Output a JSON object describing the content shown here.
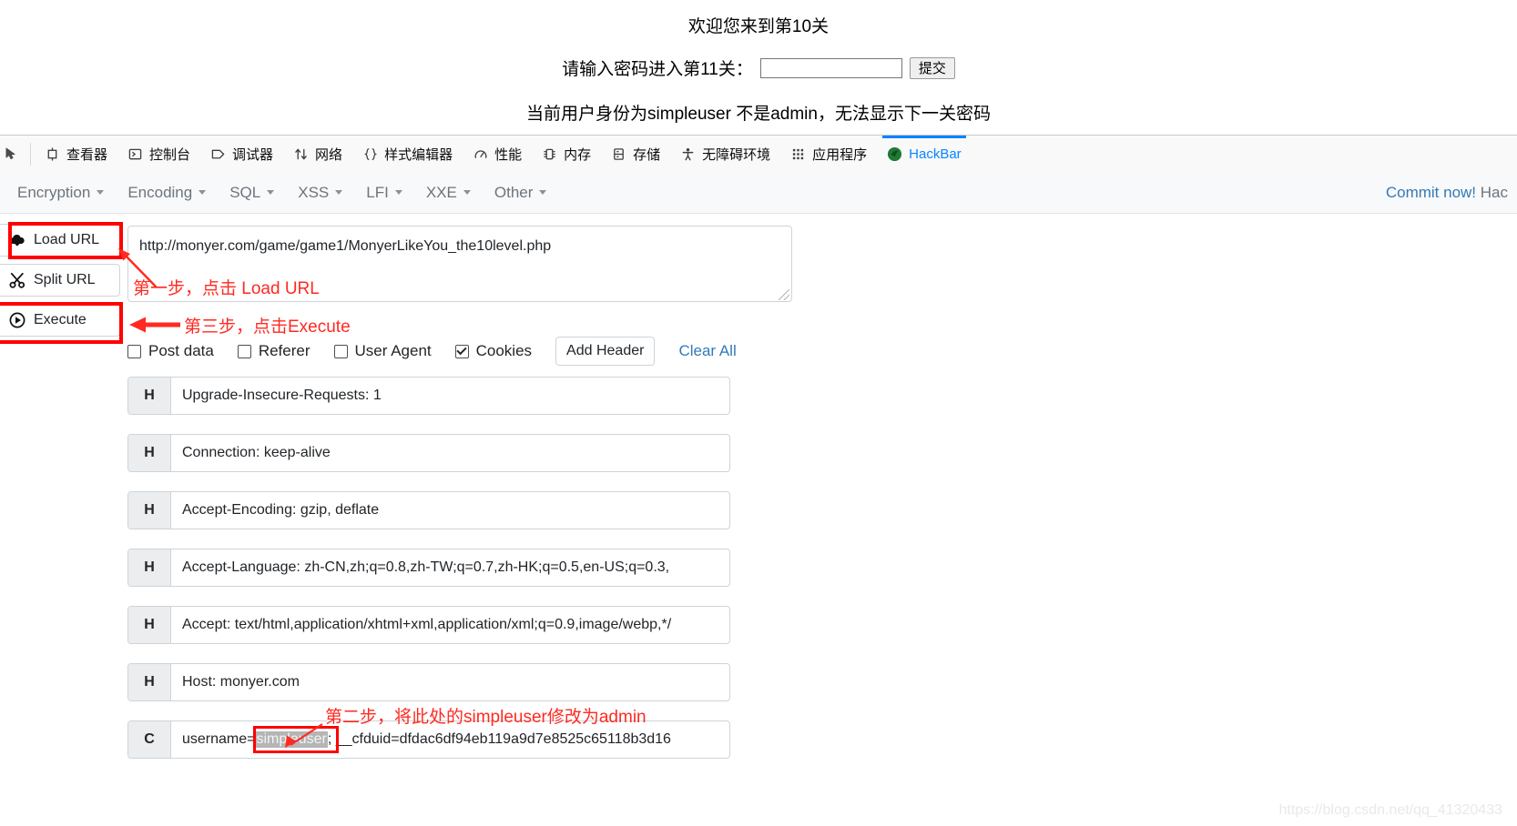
{
  "page": {
    "title": "欢迎您来到第10关",
    "password_label": "请输入密码进入第11关：",
    "password_value": "",
    "password_placeholder": "",
    "submit_label": "提交",
    "status": "当前用户身份为simpleuser 不是admin，无法显示下一关密码"
  },
  "devtools": {
    "tabs": [
      {
        "label": "查看器",
        "icon": "inspector-icon"
      },
      {
        "label": "控制台",
        "icon": "console-icon"
      },
      {
        "label": "调试器",
        "icon": "debugger-icon"
      },
      {
        "label": "网络",
        "icon": "network-icon"
      },
      {
        "label": "样式编辑器",
        "icon": "style-editor-icon"
      },
      {
        "label": "性能",
        "icon": "performance-icon"
      },
      {
        "label": "内存",
        "icon": "memory-icon"
      },
      {
        "label": "存储",
        "icon": "storage-icon"
      },
      {
        "label": "无障碍环境",
        "icon": "accessibility-icon"
      },
      {
        "label": "应用程序",
        "icon": "application-icon"
      },
      {
        "label": "HackBar",
        "icon": "hackbar-icon"
      }
    ],
    "active_tab": "HackBar"
  },
  "hackbar": {
    "menus": [
      {
        "label": "Encryption"
      },
      {
        "label": "Encoding"
      },
      {
        "label": "SQL"
      },
      {
        "label": "XSS"
      },
      {
        "label": "LFI"
      },
      {
        "label": "XXE"
      },
      {
        "label": "Other"
      }
    ],
    "commit_link": "Commit now!",
    "commit_rest": " Hac",
    "buttons": {
      "load_url": "Load URL",
      "split_url": "Split URL",
      "execute": "Execute"
    },
    "url_value": "http://monyer.com/game/game1/MonyerLikeYou_the10level.php",
    "options": [
      {
        "label": "Post data",
        "checked": false
      },
      {
        "label": "Referer",
        "checked": false
      },
      {
        "label": "User Agent",
        "checked": false
      },
      {
        "label": "Cookies",
        "checked": true
      }
    ],
    "add_header_label": "Add Header",
    "clear_all_label": "Clear All",
    "headers": [
      {
        "tag": "H",
        "value": "Upgrade-Insecure-Requests: 1"
      },
      {
        "tag": "H",
        "value": "Connection: keep-alive"
      },
      {
        "tag": "H",
        "value": "Accept-Encoding: gzip, deflate"
      },
      {
        "tag": "H",
        "value": "Accept-Language: zh-CN,zh;q=0.8,zh-TW;q=0.7,zh-HK;q=0.5,en-US;q=0.3,"
      },
      {
        "tag": "H",
        "value": "Accept: text/html,application/xhtml+xml,application/xml;q=0.9,image/webp,*/"
      },
      {
        "tag": "H",
        "value": "Host: monyer.com"
      }
    ],
    "cookie_row": {
      "tag": "C",
      "prefix": "username=",
      "selected": "simpleuser",
      "suffix": "; __cfduid=dfdac6df94eb119a9d7e8525c65118b3d16"
    }
  },
  "annotations": {
    "step1": "第一步，点击 Load URL",
    "step2": "第二步，将此处的simpleuser修改为admin",
    "step3": "第三步，点击Execute"
  },
  "watermark": "https://blog.csdn.net/qq_41320433",
  "colors": {
    "accent": "#0a84ff",
    "link": "#337ab7",
    "annotation": "#ff2a21",
    "highlight_box": "#ff0000"
  }
}
